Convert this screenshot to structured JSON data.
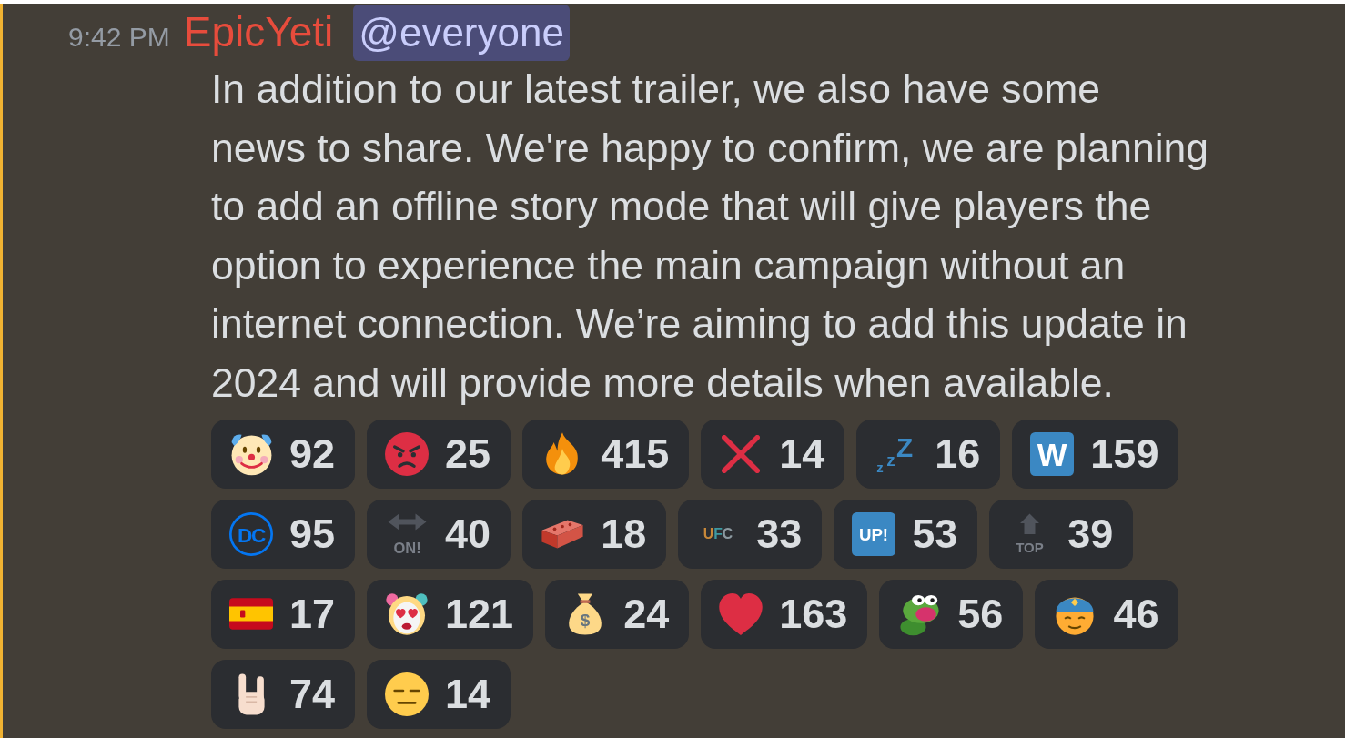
{
  "message": {
    "highlighted": true,
    "timestamp": "9:42 PM",
    "author": "EpicYeti",
    "mention": "@everyone",
    "content": "In addition to our latest trailer, we also have some\nnews to share. We're happy to confirm, we are planning\nto add an offline story mode that will give players the\noption to experience the main campaign without an\ninternet connection. We’re aiming to add this update in\n2024 and will provide more details when available.",
    "reactions": [
      {
        "kind": "clown",
        "count": "92"
      },
      {
        "kind": "angry",
        "count": "25"
      },
      {
        "kind": "fire",
        "count": "415"
      },
      {
        "kind": "cross",
        "count": "14"
      },
      {
        "kind": "sleep",
        "glyph": "zzZ",
        "count": "16"
      },
      {
        "kind": "tile",
        "glyph": "W",
        "count": "159"
      },
      {
        "kind": "ring",
        "glyph": "DC",
        "count": "95"
      },
      {
        "kind": "dimarrows",
        "glyph": "ON!",
        "count": "40"
      },
      {
        "kind": "brick",
        "count": "18"
      },
      {
        "kind": "letters",
        "glyph": "UFC",
        "count": "33"
      },
      {
        "kind": "tile",
        "glyph": "UP!",
        "count": "53"
      },
      {
        "kind": "dimup",
        "glyph": "TOP",
        "count": "39"
      },
      {
        "kind": "flag",
        "count": "17"
      },
      {
        "kind": "heartclown",
        "count": "121"
      },
      {
        "kind": "moneybag",
        "glyph": "$",
        "count": "24"
      },
      {
        "kind": "heart",
        "count": "163"
      },
      {
        "kind": "frog",
        "count": "56"
      },
      {
        "kind": "capface",
        "count": "46"
      },
      {
        "kind": "rockhand",
        "count": "74"
      },
      {
        "kind": "flatface",
        "count": "14"
      }
    ]
  }
}
